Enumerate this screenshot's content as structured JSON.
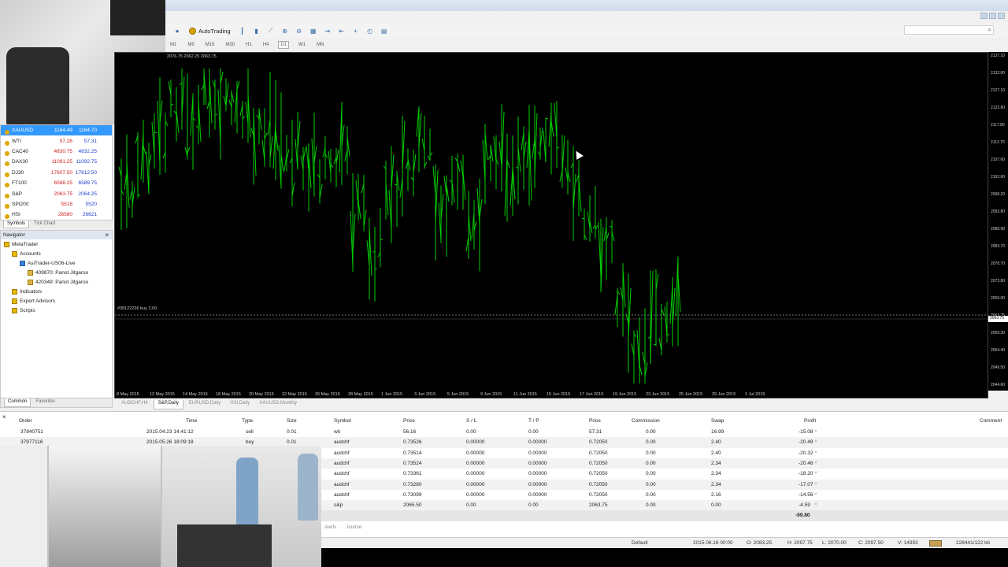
{
  "toolbar": {
    "autotrading_label": "AutoTrading",
    "timeframes": [
      "M1",
      "M5",
      "M15",
      "M30",
      "H1",
      "H4",
      "D1",
      "W1",
      "MN"
    ],
    "active_timeframe": "D1"
  },
  "market_watch": {
    "rows": [
      {
        "symbol": "XAUUSD",
        "bid": "1164.49",
        "ask": "1164.70",
        "selected": true
      },
      {
        "symbol": "WTI",
        "bid": "57.26",
        "ask": "57.31"
      },
      {
        "symbol": "CAC40",
        "bid": "4830.75",
        "ask": "4832.25"
      },
      {
        "symbol": "DAX30",
        "bid": "11091.25",
        "ask": "11092.75"
      },
      {
        "symbol": "DJ30",
        "bid": "17607.50",
        "ask": "17612.50"
      },
      {
        "symbol": "FT100",
        "bid": "6588.25",
        "ask": "6589.75"
      },
      {
        "symbol": "S&P",
        "bid": "2063.75",
        "ask": "2064.25"
      },
      {
        "symbol": "SPI200",
        "bid": "5518",
        "ask": "5520"
      },
      {
        "symbol": "HSI",
        "bid": "26580",
        "ask": "26621"
      }
    ],
    "tabs": [
      "Symbols",
      "Tick Chart"
    ]
  },
  "navigator": {
    "title": "Navigator",
    "items": [
      {
        "label": "MetaTrader",
        "indent": 1
      },
      {
        "label": "Accounts",
        "indent": 2
      },
      {
        "label": "AsiTrader-US06-Live",
        "indent": 3
      },
      {
        "label": "409870: Panot Jitgaroo",
        "indent": 4
      },
      {
        "label": "420349: Panot Jitgaroo",
        "indent": 4
      },
      {
        "label": "Indicators",
        "indent": 2
      },
      {
        "label": "Expert Advisors",
        "indent": 2
      },
      {
        "label": "Scripts",
        "indent": 2
      }
    ],
    "tabs": [
      "Common",
      "Favorites"
    ]
  },
  "chart": {
    "info": "2076.75 2062.25 2063.75",
    "order_label": "#38122236 buy 2.00",
    "price_ticks": [
      "2137.10",
      "2132.00",
      "2127.10",
      "2122.80",
      "2117.80",
      "2112.70",
      "2107.60",
      "2102.60",
      "2098.20",
      "2093.80",
      "2088.90",
      "2083.70",
      "2078.70",
      "2073.80",
      "2069.00",
      "2063.75",
      "2059.30",
      "2054.40",
      "2049.50",
      "2044.60"
    ],
    "current_price": "2063.75",
    "date_ticks": [
      "8 May 2015",
      "12 May 2015",
      "14 May 2015",
      "18 May 2015",
      "20 May 2015",
      "22 May 2015",
      "26 May 2015",
      "28 May 2015",
      "1 Jun 2015",
      "3 Jun 2015",
      "5 Jun 2015",
      "9 Jun 2015",
      "11 Jun 2015",
      "15 Jun 2015",
      "17 Jun 2015",
      "19 Jun 2015",
      "23 Jun 2015",
      "25 Jun 2015",
      "29 Jun 2015",
      "1 Jul 2015"
    ],
    "tabs": [
      "AUDCHF,H4",
      "S&P,Daily",
      "EURUSD,Daily",
      "HSI,Daily",
      "XAUUSD,Monthly"
    ],
    "active_tab": "S&P,Daily"
  },
  "terminal": {
    "headers": [
      "Order",
      "Time",
      "Type",
      "Size",
      "Symbol",
      "Price",
      "S / L",
      "T / P",
      "Price",
      "Commission",
      "Swap",
      "Profit",
      "Comment"
    ],
    "rows": [
      [
        "37840751",
        "2015.04.23 14:41:12",
        "sell",
        "0.01",
        "wti",
        "56.16",
        "0.00",
        "0.00",
        "57.31",
        "0.00",
        "16.99",
        "-15.08"
      ],
      [
        "37977116",
        "2015.05.26 18:09:18",
        "buy",
        "0.01",
        "audchf",
        "0.73526",
        "0.00000",
        "0.00000",
        "0.72050",
        "0.00",
        "2.40",
        "-20.49"
      ],
      [
        "",
        "",
        "",
        "",
        "audchf",
        "0.73514",
        "0.00000",
        "0.00000",
        "0.72050",
        "0.00",
        "2.40",
        "-20.32"
      ],
      [
        "",
        "",
        "",
        "",
        "audchf",
        "0.73524",
        "0.00000",
        "0.00000",
        "0.72050",
        "0.00",
        "2.34",
        "-20.46"
      ],
      [
        "",
        "",
        "",
        "",
        "audchf",
        "0.73361",
        "0.00000",
        "0.00000",
        "0.72050",
        "0.00",
        "2.34",
        "-18.20"
      ],
      [
        "",
        "",
        "",
        "",
        "audchf",
        "0.73280",
        "0.00000",
        "0.00000",
        "0.72050",
        "0.00",
        "2.34",
        "-17.07"
      ],
      [
        "",
        "",
        "",
        "",
        "audchf",
        "0.73099",
        "0.00000",
        "0.00000",
        "0.72050",
        "0.00",
        "2.16",
        "-14.56"
      ],
      [
        "",
        "",
        "",
        "",
        "s&p",
        "2065.50",
        "0.00",
        "0.00",
        "2063.75",
        "0.00",
        "0.00",
        "-4.59"
      ]
    ],
    "total": "-99.80",
    "tabs": [
      "Alerts",
      "Journal"
    ]
  },
  "status": {
    "profile": "Default",
    "time": "2015.06.16 00:00",
    "open": "O: 2083.25",
    "high": "H: 2097.75",
    "low": "L: 2070.00",
    "close": "C: 2097.50",
    "volume": "V: 14392",
    "traffic": "228441/122 kb"
  }
}
